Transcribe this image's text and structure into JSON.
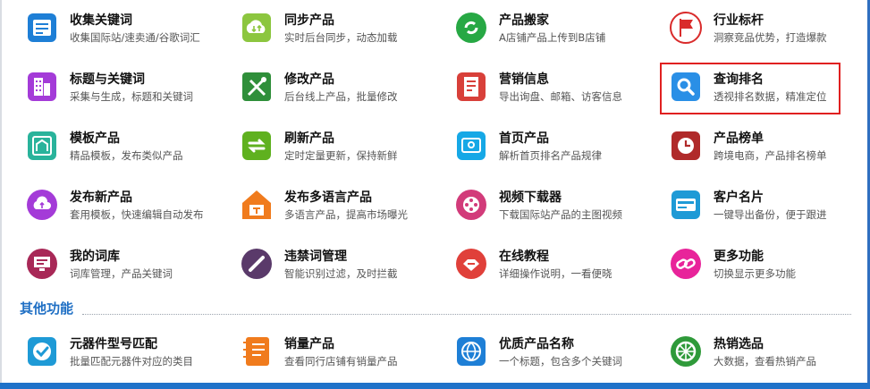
{
  "features": [
    {
      "title": "收集关键词",
      "desc": "收集国际站/速卖通/谷歌词汇",
      "icon": "keyword-collect-icon",
      "color": "#1e7fd6"
    },
    {
      "title": "同步产品",
      "desc": "实时后台同步，动态加载",
      "icon": "cloud-sync-icon",
      "color": "#8cc63f"
    },
    {
      "title": "产品搬家",
      "desc": "A店铺产品上传到B店铺",
      "icon": "move-product-icon",
      "color": "#27a844"
    },
    {
      "title": "行业标杆",
      "desc": "洞察竞品优势，打造爆款",
      "icon": "flag-icon",
      "color": "#d92b2b"
    },
    {
      "title": "标题与关键词",
      "desc": "采集与生成，标题和关键词",
      "icon": "building-icon",
      "color": "#a43bd8"
    },
    {
      "title": "修改产品",
      "desc": "后台线上产品，批量修改",
      "icon": "tools-icon",
      "color": "#2f8f3a"
    },
    {
      "title": "营销信息",
      "desc": "导出询盘、邮箱、访客信息",
      "icon": "document-icon",
      "color": "#d8403a"
    },
    {
      "title": "查询排名",
      "desc": "透视排名数据，精准定位",
      "icon": "search-icon",
      "color": "#2a8fe6"
    },
    {
      "title": "模板产品",
      "desc": "精品模板，发布类似产品",
      "icon": "template-icon",
      "color": "#29b39b"
    },
    {
      "title": "刷新产品",
      "desc": "定时定量更新，保持新鲜",
      "icon": "refresh-icon",
      "color": "#5fb11f"
    },
    {
      "title": "首页产品",
      "desc": "解析首页排名产品规律",
      "icon": "homepage-icon",
      "color": "#16a8e6"
    },
    {
      "title": "产品榜单",
      "desc": "跨境电商，产品排名榜单",
      "icon": "clock-icon",
      "color": "#b02a2a"
    },
    {
      "title": "发布新产品",
      "desc": "套用模板，快速编辑自动发布",
      "icon": "cloud-upload-icon",
      "color": "#a43bd8"
    },
    {
      "title": "发布多语言产品",
      "desc": "多语言产品，提高市场曝光",
      "icon": "multilang-icon",
      "color": "#f07b1d"
    },
    {
      "title": "视频下载器",
      "desc": "下载国际站产品的主图视频",
      "icon": "film-icon",
      "color": "#d23b7a"
    },
    {
      "title": "客户名片",
      "desc": "一键导出备份，便于跟进",
      "icon": "business-card-icon",
      "color": "#1e9ad6"
    },
    {
      "title": "我的词库",
      "desc": "词库管理，产品关键词",
      "icon": "monitor-icon",
      "color": "#a82857"
    },
    {
      "title": "违禁词管理",
      "desc": "智能识别过滤，及时拦截",
      "icon": "forbidden-icon",
      "color": "#5a3a6a"
    },
    {
      "title": "在线教程",
      "desc": "详细操作说明，一看便晓",
      "icon": "handshake-icon",
      "color": "#e0403a"
    },
    {
      "title": "更多功能",
      "desc": "切换显示更多功能",
      "icon": "link-icon",
      "color": "#e8249a"
    }
  ],
  "section": {
    "title": "其他功能"
  },
  "other_features": [
    {
      "title": "元器件型号匹配",
      "desc": "批量匹配元器件对应的类目",
      "icon": "checkbox-icon",
      "color": "#1e9ad6"
    },
    {
      "title": "销量产品",
      "desc": "查看同行店铺有销量产品",
      "icon": "notebook-icon",
      "color": "#f07b1d"
    },
    {
      "title": "优质产品名称",
      "desc": "一个标题，包含多个关键词",
      "icon": "globe-icon",
      "color": "#1e7fd6"
    },
    {
      "title": "热销选品",
      "desc": "大数据，查看热销产品",
      "icon": "wheel-icon",
      "color": "#2f9a3a"
    }
  ]
}
